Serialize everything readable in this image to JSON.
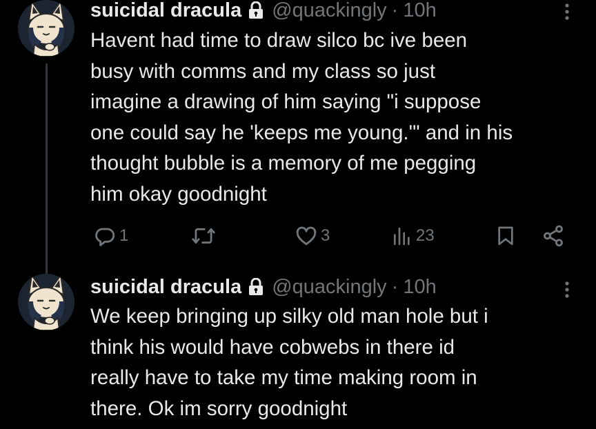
{
  "colors": {
    "background": "#000000",
    "text_primary": "#e7e9ea",
    "text_secondary": "#71767b",
    "thread_line": "#333639"
  },
  "tweets": [
    {
      "author": {
        "display_name": "suicidal dracula",
        "handle": "@quackingly",
        "protected_icon": "lock-icon",
        "avatar_icon": "cat-avatar-icon"
      },
      "separator": "·",
      "time": "10h",
      "text": "Havent had time to draw silco bc ive been\nbusy with comms and my class so just\nimagine a drawing of him saying \"i suppose\none could say he 'keeps me young.'\" and in his\nthought bubble is a memory of me pegging\nhim okay goodnight",
      "actions": {
        "replies": "1",
        "retweets": "",
        "likes": "3",
        "views": "23"
      }
    },
    {
      "author": {
        "display_name": "suicidal dracula",
        "handle": "@quackingly",
        "protected_icon": "lock-icon",
        "avatar_icon": "cat-avatar-icon"
      },
      "separator": "·",
      "time": "10h",
      "text": "We keep bringing up silky old man hole but i\nthink his would have cobwebs in there id\nreally have to take my time making room in\nthere. Ok im sorry goodnight"
    }
  ]
}
